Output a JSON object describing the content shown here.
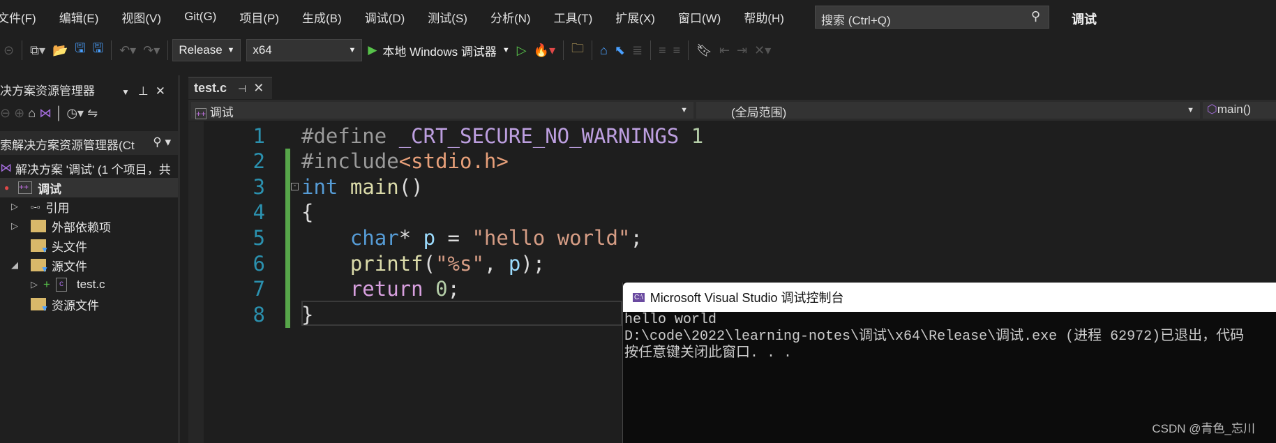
{
  "menu": [
    "文件(F)",
    "编辑(E)",
    "视图(V)",
    "Git(G)",
    "项目(P)",
    "生成(B)",
    "调试(D)",
    "测试(S)",
    "分析(N)",
    "工具(T)",
    "扩展(X)",
    "窗口(W)",
    "帮助(H)"
  ],
  "search": {
    "placeholder": "搜索 (Ctrl+Q)"
  },
  "window_title": "调试",
  "toolbar": {
    "config": "Release",
    "platform": "x64",
    "debugger": "本地 Windows 调试器"
  },
  "solution_explorer": {
    "title": "决方案资源管理器",
    "search_placeholder": "索解决方案资源管理器(Ct",
    "items": [
      {
        "label": "解决方案 '调试' (1 个项目，共",
        "indent": 0
      },
      {
        "label": "调试",
        "indent": 1,
        "bold": true
      },
      {
        "label": "引用",
        "indent": 2
      },
      {
        "label": "外部依赖项",
        "indent": 2
      },
      {
        "label": "头文件",
        "indent": 2
      },
      {
        "label": "源文件",
        "indent": 2
      },
      {
        "label": "test.c",
        "indent": 3
      },
      {
        "label": "资源文件",
        "indent": 2
      }
    ]
  },
  "editor": {
    "tab": "test.c",
    "nav": {
      "project": "调试",
      "scope": "(全局范围)",
      "member": "main()"
    },
    "lines": [
      "1",
      "2",
      "3",
      "4",
      "5",
      "6",
      "7",
      "8"
    ]
  },
  "console": {
    "title": "Microsoft Visual Studio 调试控制台",
    "lines": [
      "hello world",
      "D:\\code\\2022\\learning-notes\\调试\\x64\\Release\\调试.exe (进程 62972)已退出，代码",
      "按任意键关闭此窗口. . ."
    ]
  },
  "watermark": "CSDN @青色_忘川"
}
